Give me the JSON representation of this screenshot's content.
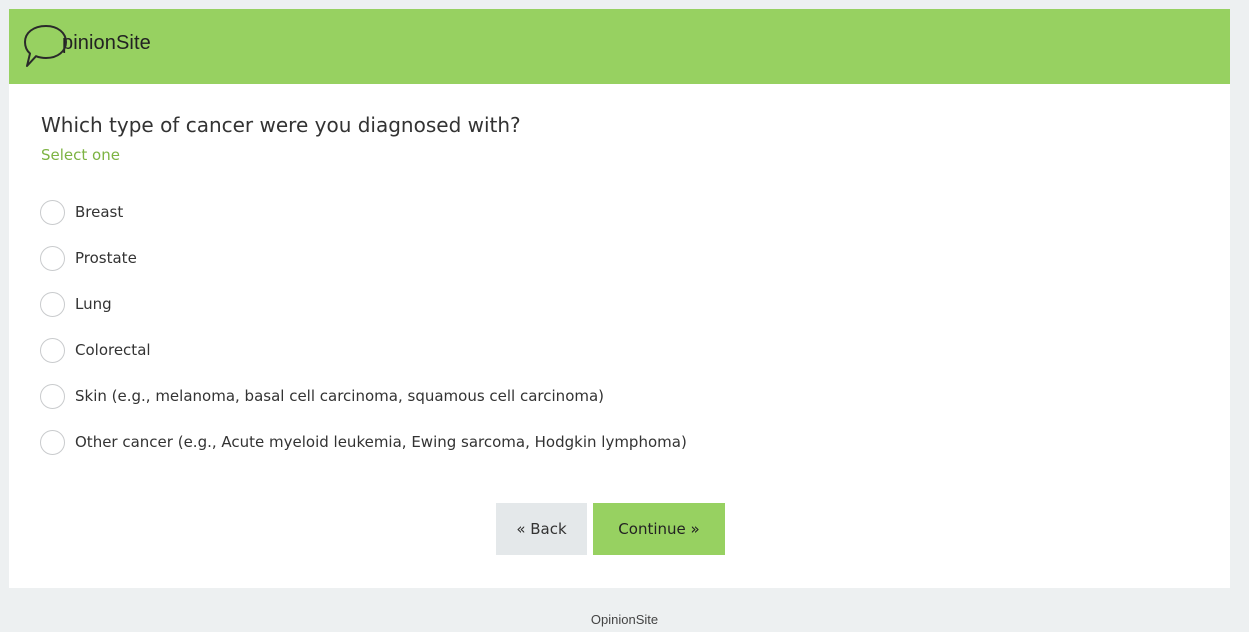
{
  "brand": {
    "logo_text": "pinionSite",
    "accent_color": "#97d161"
  },
  "question": {
    "title": "Which type of cancer were you diagnosed with?",
    "hint": "Select one"
  },
  "options": [
    {
      "label": "Breast",
      "selected": false
    },
    {
      "label": "Prostate",
      "selected": false
    },
    {
      "label": "Lung",
      "selected": false
    },
    {
      "label": "Colorectal",
      "selected": false
    },
    {
      "label": "Skin (e.g., melanoma, basal cell carcinoma, squamous cell carcinoma)",
      "selected": false
    },
    {
      "label": "Other cancer (e.g., Acute myeloid leukemia, Ewing sarcoma, Hodgkin lymphoma)",
      "selected": false
    }
  ],
  "buttons": {
    "back_label": "« Back",
    "continue_label": "Continue »"
  },
  "footer": {
    "text": "OpinionSite"
  }
}
